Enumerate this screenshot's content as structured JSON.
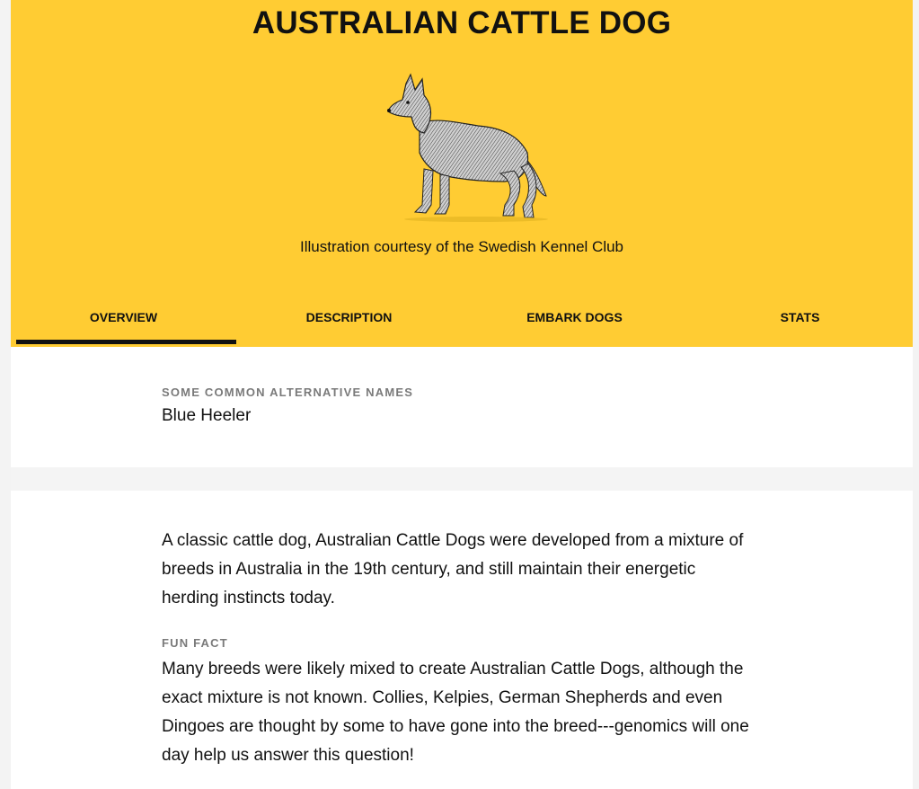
{
  "colors": {
    "header_bg": "#ffcc33",
    "text": "#111111",
    "muted": "#7a7a7a",
    "page_bg": "#f4f4f4"
  },
  "breed": {
    "title": "AUSTRALIAN CATTLE DOG",
    "image_icon": "dog-illustration",
    "caption": "Illustration courtesy of the Swedish Kennel Club"
  },
  "tabs": [
    {
      "label": "OVERVIEW",
      "active": true
    },
    {
      "label": "DESCRIPTION",
      "active": false
    },
    {
      "label": "EMBARK DOGS",
      "active": false
    },
    {
      "label": "STATS",
      "active": false
    }
  ],
  "alternative_names": {
    "label": "SOME COMMON ALTERNATIVE NAMES",
    "value": "Blue Heeler"
  },
  "overview": {
    "description": "A classic cattle dog, Australian Cattle Dogs were developed from a mixture of breeds in Australia in the 19th century, and still maintain their energetic herding instincts today.",
    "fun_fact_label": "FUN FACT",
    "fun_fact": "Many breeds were likely mixed to create Australian Cattle Dogs, although the exact mixture is not known. Collies, Kelpies, German Shepherds and even Dingoes are thought by some to have gone into the breed---genomics will one day help us answer this question!"
  }
}
